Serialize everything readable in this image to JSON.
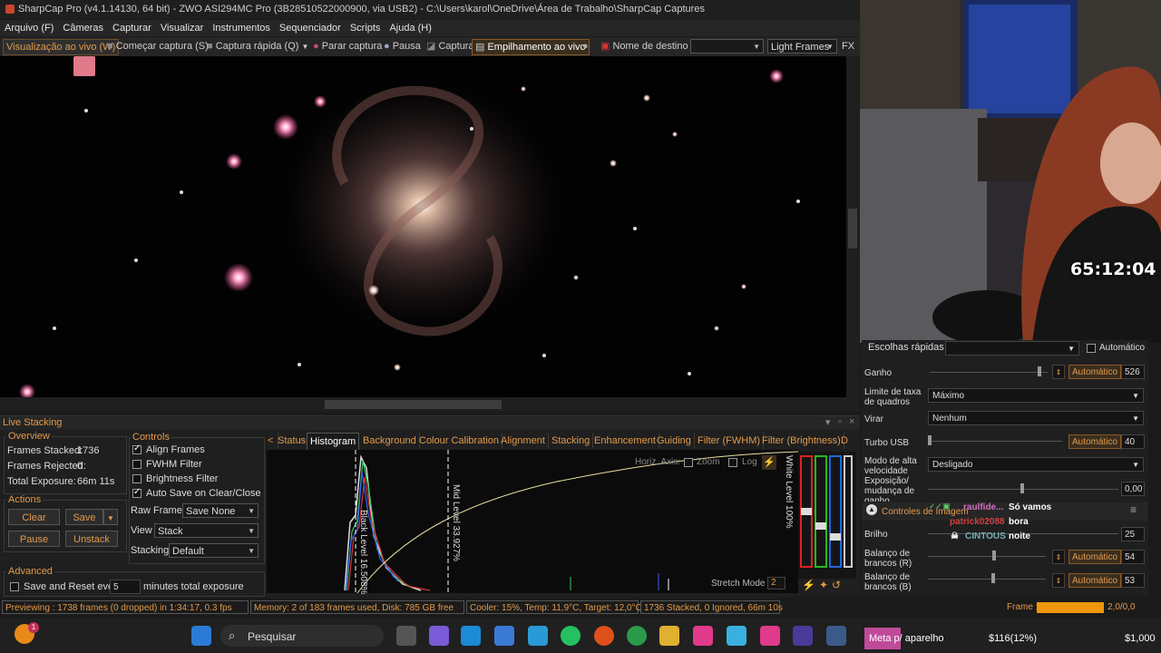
{
  "window": {
    "title": "SharpCap Pro (v4.1.14130, 64 bit) - ZWO ASI294MC Pro (3B28510522000900, via USB2) - C:\\Users\\karol\\OneDrive\\Área de Trabalho\\SharpCap Captures"
  },
  "menu": [
    "Arquivo (F)",
    "Câmeras",
    "Capturar",
    "Visualizar",
    "Instrumentos",
    "Sequenciador",
    "Scripts",
    "Ajuda (H)"
  ],
  "toolbar": {
    "live_view": "Visualização ao vivo (W)",
    "start_capture": "Começar captura (S)",
    "quick_capture": "Captura rápida (Q)",
    "stop_capture": "Parar captura",
    "pause": "Pausa",
    "capture": "Captura",
    "live_stacking": "Empilhamento ao vivo",
    "target_name_label": "Nome de destino",
    "target_name_value": "",
    "frame_type": "Light Frames",
    "fx": "FX"
  },
  "live_stacking": {
    "title": "Live Stacking",
    "overview": {
      "label": "Overview",
      "frames_stacked_label": "Frames Stacked:",
      "frames_stacked": "1736",
      "frames_rejected_label": "Frames Rejected:",
      "frames_rejected": "0",
      "total_exposure_label": "Total Exposure:",
      "total_exposure": "66m 11s"
    },
    "actions": {
      "label": "Actions",
      "clear": "Clear",
      "save": "Save",
      "pause": "Pause",
      "unstack": "Unstack"
    },
    "controls": {
      "label": "Controls",
      "align_frames": "Align Frames",
      "fwhm_filter": "FWHM Filter",
      "brightness_filter": "Brightness Filter",
      "auto_save": "Auto Save on Clear/Close",
      "raw_frames_label": "Raw Frames",
      "raw_frames_value": "Save None",
      "view_label": "View",
      "view_value": "Stack",
      "stacking_label": "Stacking",
      "stacking_value": "Default"
    },
    "advanced": {
      "label": "Advanced",
      "save_reset_label": "Save and Reset every",
      "minutes_value": "5",
      "minutes_suffix": "minutes total exposure"
    },
    "tabs": [
      "Status",
      "Histogram",
      "Background",
      "Colour Calibration",
      "Alignment",
      "Stacking",
      "Enhancement",
      "Guiding",
      "Filter (FWHM)",
      "Filter (Brightness)",
      "D"
    ],
    "active_tab": "Histogram",
    "histogram": {
      "horiz_axis": "Horiz. Axis:",
      "zoom": "Zoom",
      "log": "Log",
      "black_level": "Black Level 16.508%",
      "mid_level": "Mid Level 33.927%",
      "white_level": "White Level 100%",
      "stretch_mode": "Stretch Mode",
      "stretch_value": "2"
    }
  },
  "right_panel": {
    "quick_picks": "Escolhas rápidas",
    "auto_check": "Automático",
    "gain_label": "Ganho",
    "gain_auto": "Automático",
    "gain_value": "526",
    "frame_rate_label": "Limite de taxa de quadros",
    "frame_rate_value": "Máximo",
    "flip_label": "Virar",
    "flip_value": "Nenhum",
    "usb_label": "Turbo USB",
    "usb_auto": "Automático",
    "usb_value": "40",
    "high_speed_label": "Modo de alta velocidade",
    "high_speed_value": "Desligado",
    "exposure_change_label": "Exposição/ mudança de ganho",
    "exposure_change_value": "0,00",
    "image_controls": "Controles de Imagem",
    "brightness_label": "Brilho",
    "brightness_value": "25",
    "wb_r_label": "Balanço de brancos (R)",
    "wb_r_auto": "Automático",
    "wb_r_value": "54",
    "wb_b_label": "Balanço de brancos (B)",
    "wb_b_auto": "Automático",
    "wb_b_value": "53",
    "wb_more": "brancos (B)"
  },
  "stream": {
    "timer": "65:12:04",
    "chat": [
      {
        "user": "raulfide...",
        "text": "Só vamos"
      },
      {
        "user": "patrick02088",
        "text": "bora"
      },
      {
        "user": "CINTOUS",
        "text": "noite"
      }
    ]
  },
  "status": {
    "preview": "Previewing : 1738 frames (0 dropped) in 1:34:17, 0.3 fps",
    "memory": "Memory: 2 of 183 frames used, Disk: 785 GB free",
    "cooler": "Cooler: 15%, Temp: 11,9°C, Target: 12,0°C",
    "stacked": "1736 Stacked, 0 Ignored, 66m 10s",
    "frame_label": "Frame :",
    "frame_value": "2,0/0,0"
  },
  "taskbar": {
    "search": "Pesquisar",
    "meta": "Meta p/ aparelho",
    "amount1": "$116(12%)",
    "amount2": "$1,000",
    "badge": "1"
  },
  "colors": {
    "accent": "#e39a4a",
    "bg": "#1f1f1f"
  }
}
